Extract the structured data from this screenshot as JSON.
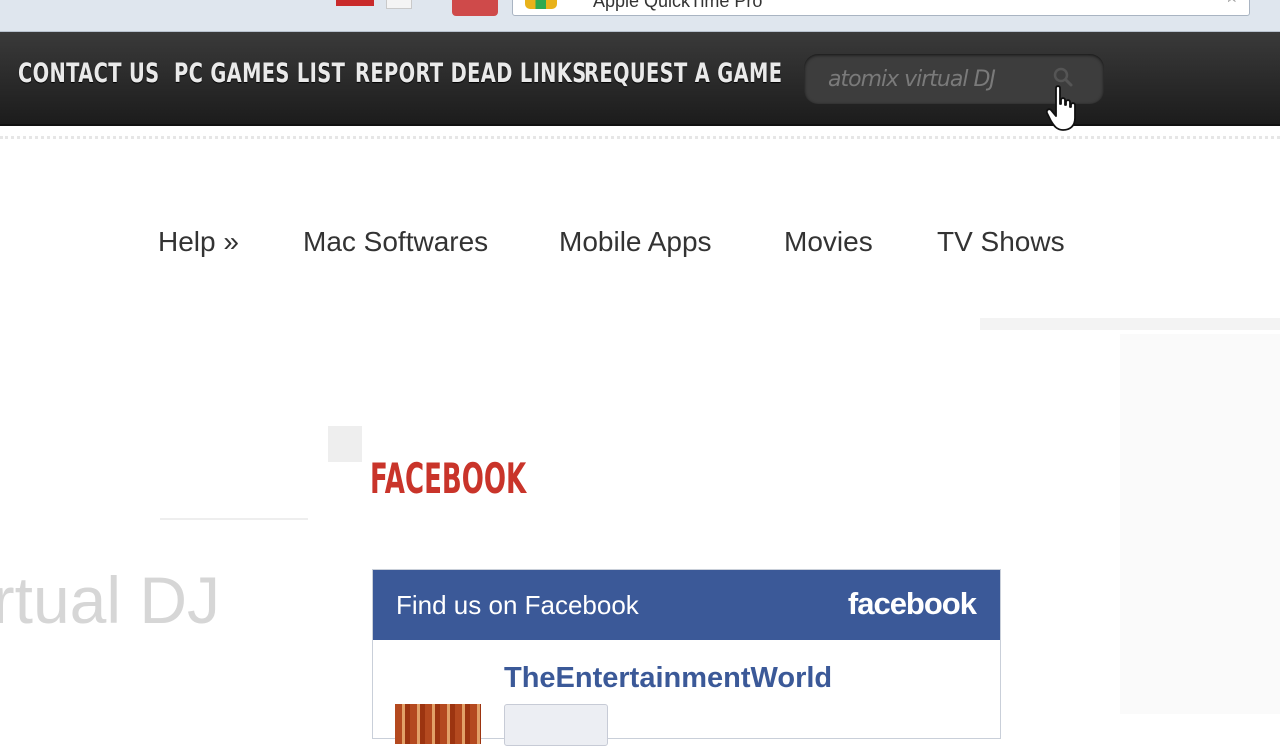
{
  "browser": {
    "omnibox_text": "Apple QuickTime Pro",
    "star_glyph": "☆"
  },
  "topnav": {
    "items": [
      {
        "label": "CONTACT US"
      },
      {
        "label": "PC GAMES LIST"
      },
      {
        "label": "REPORT DEAD LINKS"
      },
      {
        "label": "REQUEST A GAME"
      }
    ],
    "search": {
      "value": "atomix virtual DJ"
    }
  },
  "subnav": {
    "items": [
      {
        "label": "Help »"
      },
      {
        "label": "Mac Softwares"
      },
      {
        "label": "Mobile Apps"
      },
      {
        "label": "Movies"
      },
      {
        "label": "TV Shows"
      }
    ]
  },
  "main": {
    "post_title_partial": "irtual DJ"
  },
  "sidebar": {
    "heading": "FACEBOOK",
    "facebook_widget": {
      "header_text": "Find us on Facebook",
      "logo_text": "facebook",
      "page_name": "TheEntertainmentWorld"
    }
  },
  "colors": {
    "nav_bg": "#2a2a2a",
    "heading_red": "#c9342a",
    "facebook_blue": "#3b5998"
  }
}
